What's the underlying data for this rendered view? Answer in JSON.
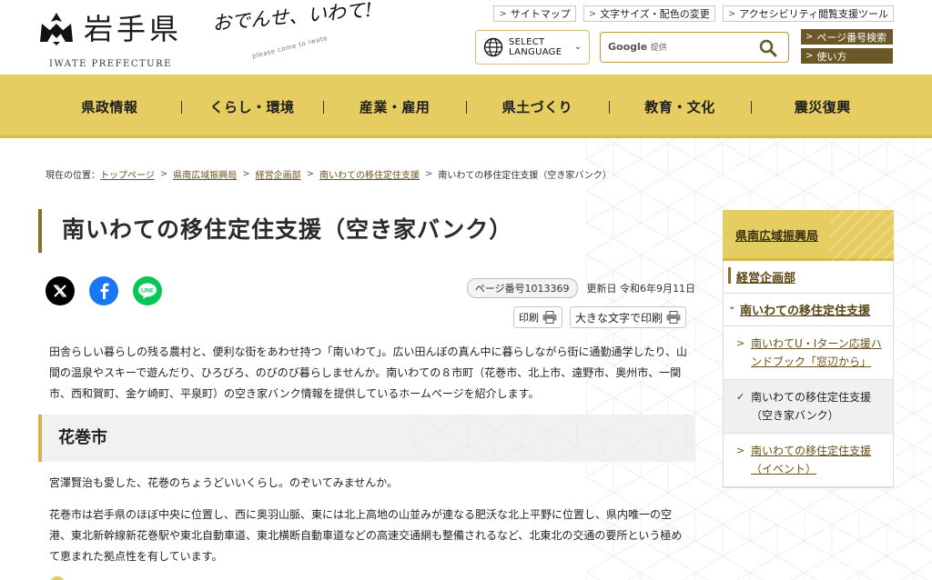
{
  "header": {
    "logo_text": "岩手県",
    "logo_en": "IWATE PREFECTURE",
    "slogan": "おでんせ、いわて!",
    "slogan_sub": "please come to iwate",
    "util_links": [
      "サイトマップ",
      "文字サイズ・配色の変更",
      "アクセシビリティ閲覧支援ツール"
    ],
    "lang_line1": "SELECT",
    "lang_line2": "LANGUAGE",
    "search_brand": "Google",
    "search_suffix": "提供",
    "page_number_search": "ページ番号検索",
    "how_to_use": "使い方"
  },
  "gnav": [
    "県政情報",
    "くらし・環境",
    "産業・雇用",
    "県土づくり",
    "教育・文化",
    "震災復興"
  ],
  "breadcrumb": {
    "label": "現在の位置：",
    "items": [
      "トップページ",
      "県南広域振興局",
      "経営企画部",
      "南いわての移住定住支援"
    ],
    "current": "南いわての移住定住支援（空き家バンク）"
  },
  "main": {
    "title": "南いわての移住定住支援（空き家バンク）",
    "page_number": "ページ番号1013369",
    "updated": "更新日 令和6年9月11日",
    "print": "印刷",
    "print_large": "大きな文字で印刷",
    "intro": "田舎らしい暮らしの残る農村と、便利な街をあわせ持つ「南いわて」。広い田んぼの真ん中に暮らしながら街に通勤通学したり、山間の温泉やスキーで遊んだり、ひろびろ、のびのび暮らしませんか。南いわての８市町（花巻市、北上市、遠野市、奥州市、一関市、西和賀町、金ケ崎町、平泉町）の空き家バンク情報を提供しているホームページを紹介します。",
    "section_title": "花巻市",
    "section_p1": "宮澤賢治も愛した、花巻のちょうどいいくらし。のぞいてみませんか。",
    "section_p2": "花巻市は岩手県のほぼ中央に位置し、西に奥羽山脈、東には北上高地の山並みが連なる肥沃な北上平野に位置し、県内唯一の空港、東北新幹線新花巻駅や東北自動車道、東北横断自動車道などの高速交通網も整備されるなど、北東北の交通の要所という極めて恵まれた拠点性を有しています。"
  },
  "sidenav": {
    "head": "県南広域振興局",
    "l1_a": "経営企画部",
    "l1_b": "南いわての移住定住支援",
    "items": [
      "南いわてU・Iターン応援ハンドブック「窓辺から」",
      "南いわての移住定住支援（空き家バンク）",
      "南いわての移住定住支援（イベント）"
    ]
  },
  "colors": {
    "accent_yellow": "#e6cd62",
    "accent_brown": "#6b5727",
    "link_brown": "#6b5218"
  }
}
